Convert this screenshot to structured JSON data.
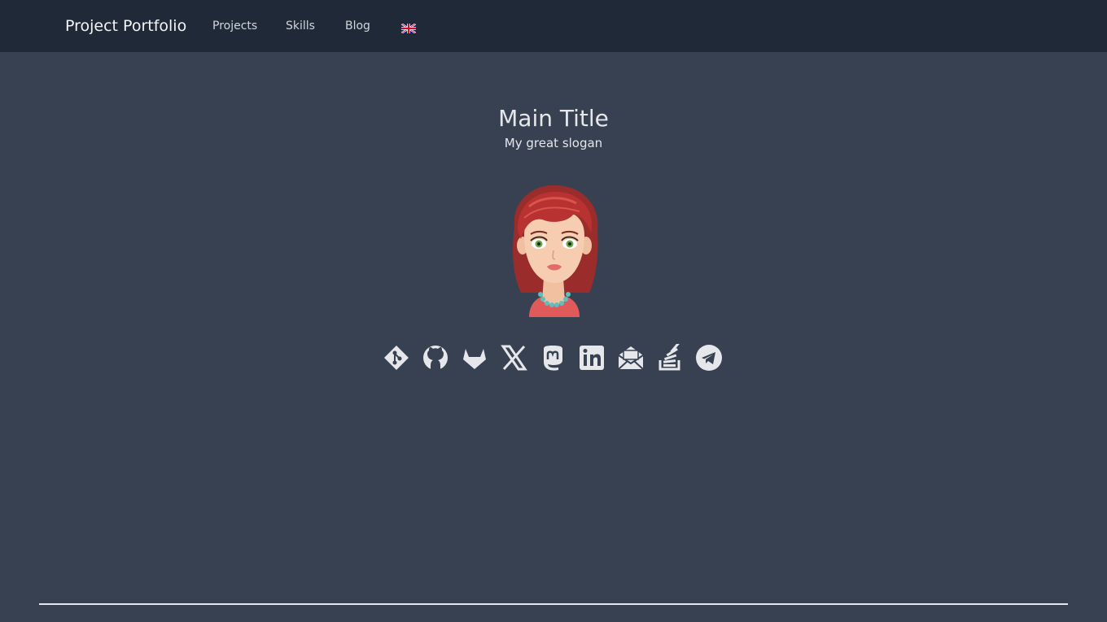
{
  "navbar": {
    "brand": "Project Portfolio",
    "links": [
      {
        "label": "Projects"
      },
      {
        "label": "Skills"
      },
      {
        "label": "Blog"
      }
    ],
    "language_icon": "uk-flag-icon"
  },
  "hero": {
    "title": "Main Title",
    "slogan": "My great slogan"
  },
  "socials": [
    {
      "icon": "git-icon"
    },
    {
      "icon": "github-icon"
    },
    {
      "icon": "gitlab-icon"
    },
    {
      "icon": "x-twitter-icon"
    },
    {
      "icon": "mastodon-icon"
    },
    {
      "icon": "linkedin-icon"
    },
    {
      "icon": "email-icon"
    },
    {
      "icon": "stackoverflow-icon"
    },
    {
      "icon": "telegram-icon"
    }
  ],
  "colors": {
    "background": "#374151",
    "navbar": "#1f2937",
    "text": "#e5e7eb"
  }
}
